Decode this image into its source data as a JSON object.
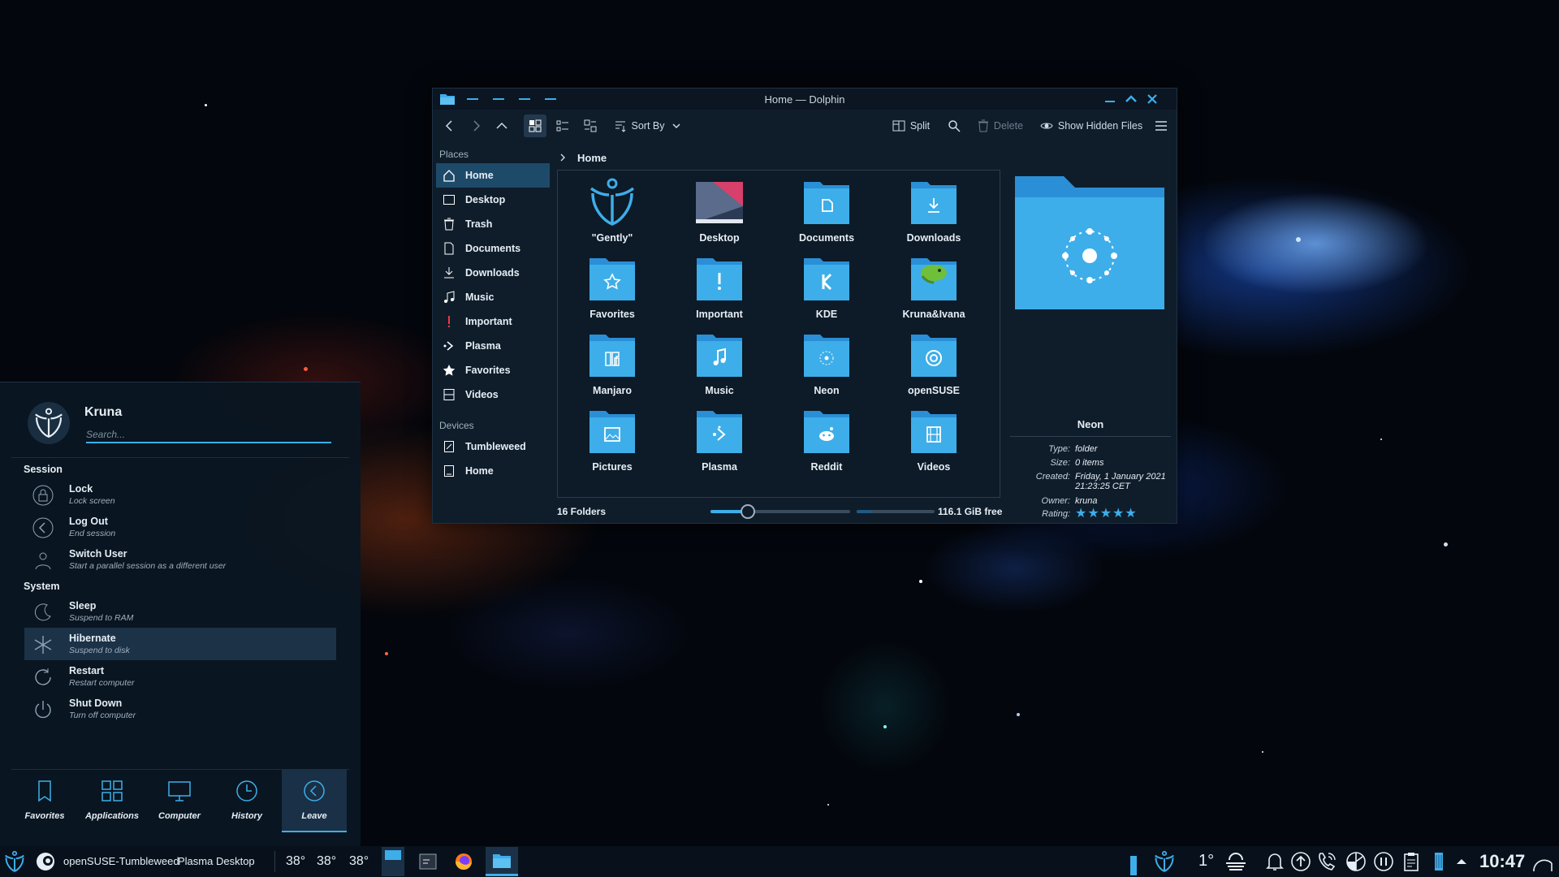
{
  "dolphin": {
    "title": "Home — Dolphin",
    "toolbar": {
      "sort_by": "Sort By",
      "split": "Split",
      "delete": "Delete",
      "show_hidden": "Show Hidden Files"
    },
    "places": {
      "section_places": "Places",
      "items": [
        "Home",
        "Desktop",
        "Trash",
        "Documents",
        "Downloads",
        "Music",
        "Important",
        "Plasma",
        "Favorites",
        "Videos"
      ],
      "section_devices": "Devices",
      "devices": [
        "Tumbleweed",
        "Home"
      ]
    },
    "breadcrumb": "Home",
    "folders": [
      "\"Gently\"",
      "Desktop",
      "Documents",
      "Downloads",
      "Favorites",
      "Important",
      "KDE",
      "Kruna&Ivana",
      "Manjaro",
      "Music",
      "Neon",
      "openSUSE",
      "Pictures",
      "Plasma",
      "Reddit",
      "Videos"
    ],
    "info": {
      "name": "Neon",
      "type_label": "Type:",
      "type": "folder",
      "size_label": "Size:",
      "size": "0 items",
      "created_label": "Created:",
      "created": "Friday, 1 January 2021 21:23:25 CET",
      "owner_label": "Owner:",
      "owner": "kruna",
      "rating_label": "Rating:",
      "rating": 5
    },
    "status": {
      "count": "16 Folders",
      "free": "116.1 GiB free",
      "zoom": 0.27
    },
    "accent": "#3daee9"
  },
  "kickoff": {
    "user": "Kruna",
    "search_placeholder": "Search...",
    "session_label": "Session",
    "session": [
      {
        "title": "Lock",
        "subtitle": "Lock screen"
      },
      {
        "title": "Log Out",
        "subtitle": "End session"
      },
      {
        "title": "Switch User",
        "subtitle": "Start a parallel session as a different user"
      }
    ],
    "system_label": "System",
    "system": [
      {
        "title": "Sleep",
        "subtitle": "Suspend to RAM"
      },
      {
        "title": "Hibernate",
        "subtitle": "Suspend to disk"
      },
      {
        "title": "Restart",
        "subtitle": "Restart computer"
      },
      {
        "title": "Shut Down",
        "subtitle": "Turn off computer"
      }
    ],
    "tabs": [
      "Favorites",
      "Applications",
      "Computer",
      "History",
      "Leave"
    ]
  },
  "panel": {
    "distro": "openSUSE-Tumbleweed",
    "desktop": "Plasma Desktop",
    "temps": [
      "38°",
      "38°",
      "38°"
    ],
    "weather": "1°",
    "clock": "10:47"
  }
}
